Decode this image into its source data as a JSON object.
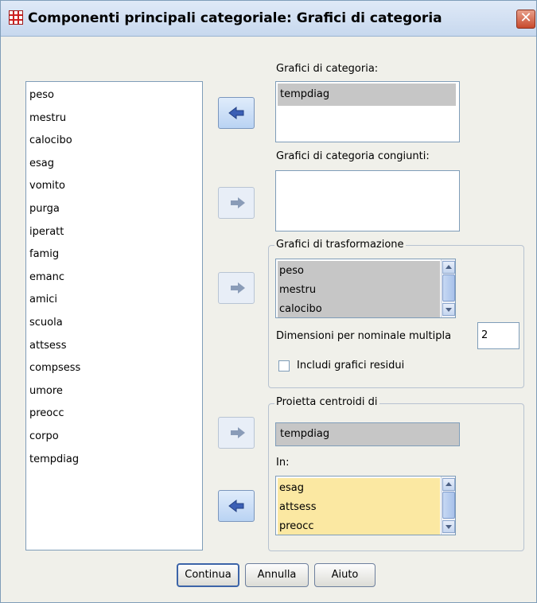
{
  "window": {
    "title": "Componenti principali categoriale: Grafici di categoria",
    "close_glyph": "✕"
  },
  "source_list": {
    "items": [
      "peso",
      "mestru",
      "calocibo",
      "esag",
      "vomito",
      "purga",
      "iperatt",
      "famig",
      "emanc",
      "amici",
      "scuola",
      "attsess",
      "compsess",
      "umore",
      "preocc",
      "corpo",
      "tempdiag"
    ]
  },
  "category_plots": {
    "label": "Grafici di categoria:",
    "items": [
      "tempdiag"
    ]
  },
  "joint_category_plots": {
    "label": "Grafici di categoria congiunti:",
    "items": []
  },
  "transformation_plots": {
    "legend": "Grafici di trasformazione",
    "items": [
      "peso",
      "mestru",
      "calocibo"
    ],
    "dimensions_label": "Dimensioni per nominale multipla",
    "dimensions_value": "2",
    "include_residuals_label": "Includi grafici residui",
    "include_residuals_checked": false
  },
  "project_centroids": {
    "legend": "Proietta centroidi di",
    "variable": "tempdiag",
    "in_label": "In:",
    "in_items": [
      "esag",
      "attsess",
      "preocc"
    ]
  },
  "buttons": {
    "continue": "Continua",
    "cancel": "Annulla",
    "help": "Aiuto"
  },
  "colors": {
    "accent_arrow": "#3b5fb5",
    "disabled_arrow": "#8a9cb8",
    "selection_gray": "#c6c6c6",
    "highlight_yellow": "#fbe8a2"
  },
  "icons": {
    "app": "spss-grid-icon",
    "close": "close-icon",
    "move_left": "arrow-left-icon",
    "move_right": "arrow-right-icon"
  }
}
